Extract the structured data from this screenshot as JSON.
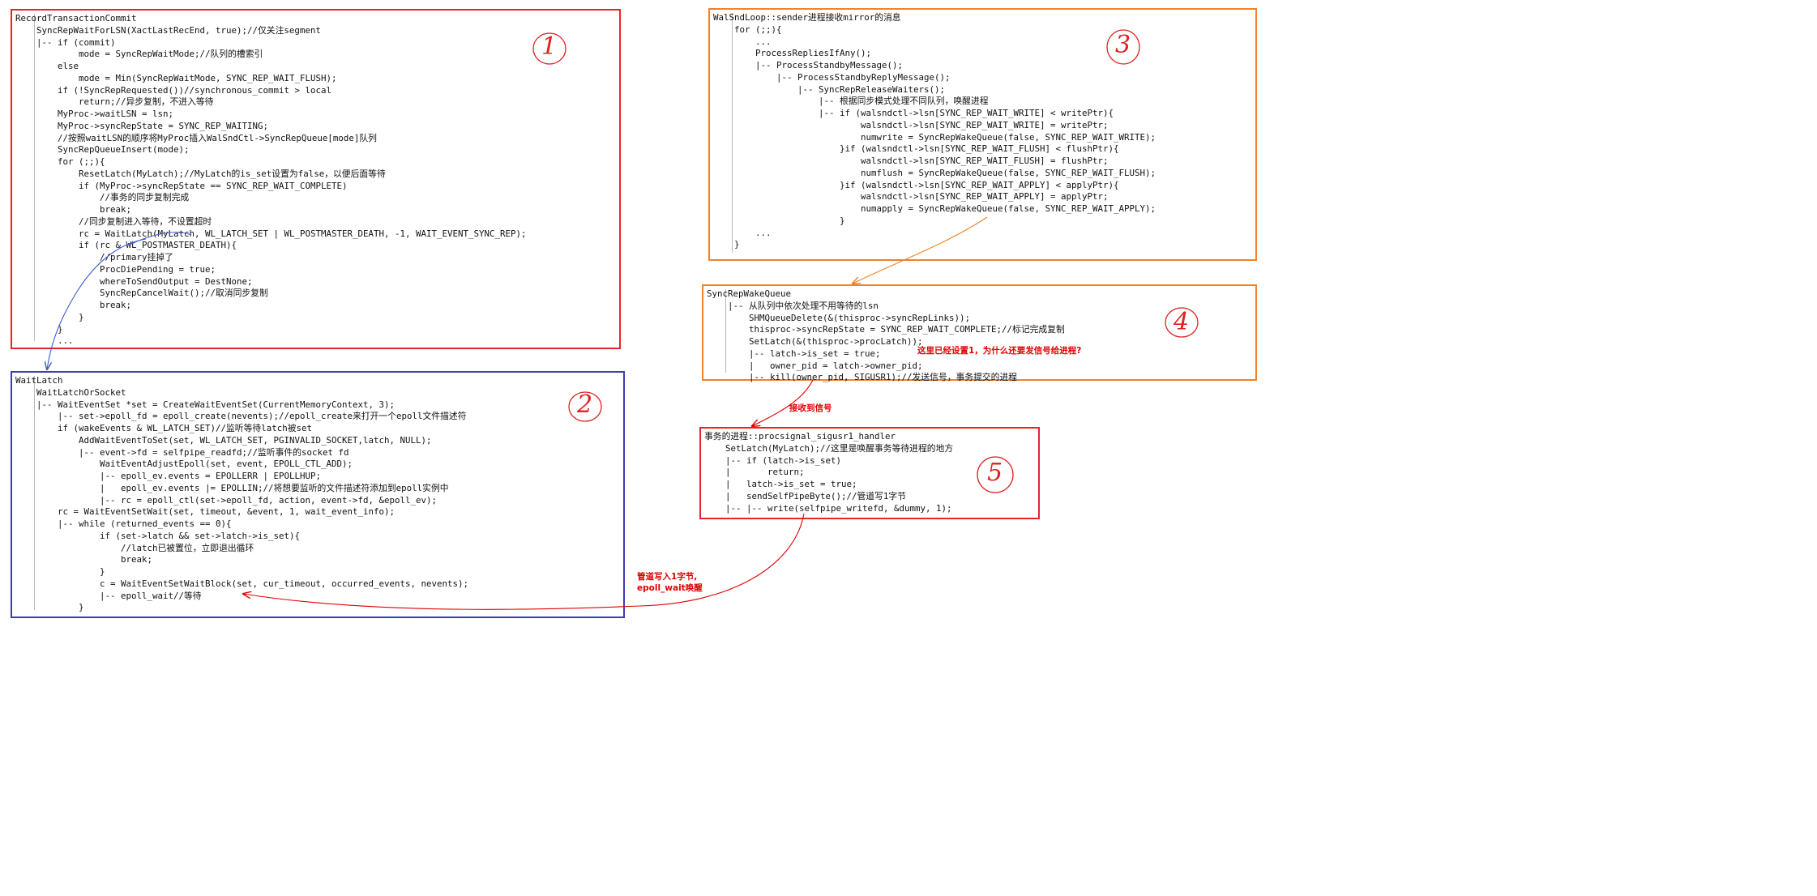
{
  "colors": {
    "box1": "#e8242b",
    "box2": "#3c3cb5",
    "box3": "#f0822a",
    "box4": "#f0822a",
    "box5": "#e8242b",
    "note": "#e00000",
    "arrow_blue": "#3a5ad0"
  },
  "box1": {
    "badge": "1",
    "code": "RecordTransactionCommit\n    SyncRepWaitForLSN(XactLastRecEnd, true);//仅关注segment\n    |-- if (commit)\n            mode = SyncRepWaitMode;//队列的槽索引\n        else\n            mode = Min(SyncRepWaitMode, SYNC_REP_WAIT_FLUSH);\n        if (!SyncRepRequested())//synchronous_commit > local\n            return;//异步复制，不进入等待\n        MyProc->waitLSN = lsn;\n        MyProc->syncRepState = SYNC_REP_WAITING;\n        //按照waitLSN的顺序将MyProc插入WalSndCtl->SyncRepQueue[mode]队列\n        SyncRepQueueInsert(mode);\n        for (;;){\n            ResetLatch(MyLatch);//MyLatch的is_set设置为false，以便后面等待\n            if (MyProc->syncRepState == SYNC_REP_WAIT_COMPLETE)\n                //事务的同步复制完成\n                break;\n            //同步复制进入等待，不设置超时\n            rc = WaitLatch(MyLatch, WL_LATCH_SET | WL_POSTMASTER_DEATH, -1, WAIT_EVENT_SYNC_REP);\n            if (rc & WL_POSTMASTER_DEATH){\n                //primary挂掉了\n                ProcDiePending = true;\n                whereToSendOutput = DestNone;\n                SyncRepCancelWait();//取消同步复制\n                break;\n            }\n        }\n        ..."
  },
  "box2": {
    "badge": "2",
    "code": "WaitLatch\n    WaitLatchOrSocket\n    |-- WaitEventSet *set = CreateWaitEventSet(CurrentMemoryContext, 3);\n        |-- set->epoll_fd = epoll_create(nevents);//epoll_create来打开一个epoll文件描述符\n        if (wakeEvents & WL_LATCH_SET)//监听等待latch被set\n            AddWaitEventToSet(set, WL_LATCH_SET, PGINVALID_SOCKET,latch, NULL);\n            |-- event->fd = selfpipe_readfd;//监听事件的socket fd\n                WaitEventAdjustEpoll(set, event, EPOLL_CTL_ADD);\n                |-- epoll_ev.events = EPOLLERR | EPOLLHUP;\n                |   epoll_ev.events |= EPOLLIN;//将想要监听的文件描述符添加到epoll实例中\n                |-- rc = epoll_ctl(set->epoll_fd, action, event->fd, &epoll_ev);\n        rc = WaitEventSetWait(set, timeout, &event, 1, wait_event_info);\n        |-- while (returned_events == 0){\n                if (set->latch && set->latch->is_set){\n                    //latch已被置位，立即退出循环\n                    break;\n                }\n                c = WaitEventSetWaitBlock(set, cur_timeout, occurred_events, nevents);\n                |-- epoll_wait//等待\n            }"
  },
  "box3": {
    "badge": "3",
    "code": "WalSndLoop::sender进程接收mirror的消息\n    for (;;){\n        ...\n        ProcessRepliesIfAny();\n        |-- ProcessStandbyMessage();\n            |-- ProcessStandbyReplyMessage();\n                |-- SyncRepReleaseWaiters();\n                    |-- 根据同步模式处理不同队列，唤醒进程\n                    |-- if (walsndctl->lsn[SYNC_REP_WAIT_WRITE] < writePtr){\n                            walsndctl->lsn[SYNC_REP_WAIT_WRITE] = writePtr;\n                            numwrite = SyncRepWakeQueue(false, SYNC_REP_WAIT_WRITE);\n                        }if (walsndctl->lsn[SYNC_REP_WAIT_FLUSH] < flushPtr){\n                            walsndctl->lsn[SYNC_REP_WAIT_FLUSH] = flushPtr;\n                            numflush = SyncRepWakeQueue(false, SYNC_REP_WAIT_FLUSH);\n                        }if (walsndctl->lsn[SYNC_REP_WAIT_APPLY] < applyPtr){\n                            walsndctl->lsn[SYNC_REP_WAIT_APPLY] = applyPtr;\n                            numapply = SyncRepWakeQueue(false, SYNC_REP_WAIT_APPLY);\n                        }\n        ...\n    }"
  },
  "box4": {
    "badge": "4",
    "code": "SyncRepWakeQueue\n    |-- 从队列中依次处理不用等待的lsn\n        SHMQueueDelete(&(thisproc->syncRepLinks));\n        thisproc->syncRepState = SYNC_REP_WAIT_COMPLETE;//标记完成复制\n        SetLatch(&(thisproc->procLatch));\n        |-- latch->is_set = true;\n        |   owner_pid = latch->owner_pid;\n        |-- kill(owner_pid, SIGUSR1);//发送信号，事务提交的进程",
    "note": "这里已经设置1，为什么还要发信号给进程?"
  },
  "box5": {
    "badge": "5",
    "code": "事务的进程::procsignal_sigusr1_handler\n    SetLatch(MyLatch);//这里是唤醒事务等待进程的地方\n    |-- if (latch->is_set)\n    |       return;\n    |   latch->is_set = true;\n    |   sendSelfPipeByte();//管道写1字节\n    |-- |-- write(selfpipe_writefd, &dummy, 1);"
  },
  "notes": {
    "signal": "接收到信号",
    "pipe": "管道写入1字节,\nepoll_wait唤醒"
  }
}
